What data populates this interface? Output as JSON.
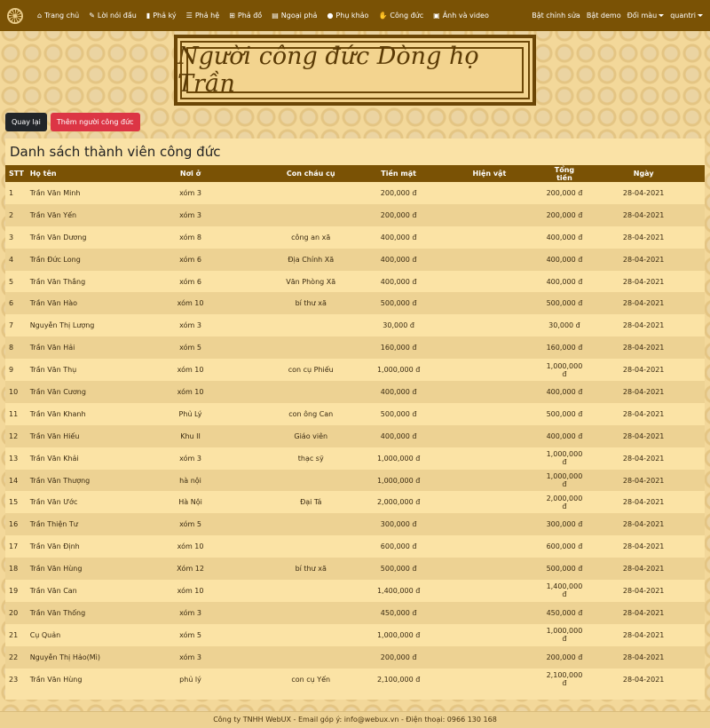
{
  "nav": {
    "items": [
      {
        "icon": "⌂",
        "label": "Trang chủ"
      },
      {
        "icon": "✎",
        "label": "Lời nói đầu"
      },
      {
        "icon": "▮",
        "label": "Phả ký"
      },
      {
        "icon": "☰",
        "label": "Phả hệ"
      },
      {
        "icon": "⊞",
        "label": "Phả đồ"
      },
      {
        "icon": "▤",
        "label": "Ngoại phả"
      },
      {
        "icon": "●",
        "label": "Phụ khảo"
      },
      {
        "icon": "✋",
        "label": "Công đức"
      },
      {
        "icon": "▣",
        "label": "Ảnh và video"
      }
    ],
    "right": {
      "edit": "Bật chỉnh sửa",
      "demo": "Bật demo",
      "color": "Đổi màu",
      "user": "quantri"
    }
  },
  "banner": {
    "title": "Người công đức Dòng họ Trần"
  },
  "actions": {
    "back": "Quay lại",
    "add": "Thêm người công đức"
  },
  "panel": {
    "title": "Danh sách thành viên công đức"
  },
  "table": {
    "headers": [
      "STT",
      "Họ tên",
      "Nơi ở",
      "Con cháu cụ",
      "Tiền mặt",
      "Hiện vật",
      "Tổng tiền",
      "Ngày"
    ],
    "rows": [
      [
        "1",
        "Trần Văn Minh",
        "xóm 3",
        "",
        "200,000 đ",
        "",
        "200,000 đ",
        "28-04-2021"
      ],
      [
        "2",
        "Trần Văn Yến",
        "xóm 3",
        "",
        "200,000 đ",
        "",
        "200,000 đ",
        "28-04-2021"
      ],
      [
        "3",
        "Trần Văn Dương",
        "xóm 8",
        "công an xã",
        "400,000 đ",
        "",
        "400,000 đ",
        "28-04-2021"
      ],
      [
        "4",
        "Trần Đức Long",
        "xóm 6",
        "Địa Chính Xã",
        "400,000 đ",
        "",
        "400,000 đ",
        "28-04-2021"
      ],
      [
        "5",
        "Trần Văn Thắng",
        "xóm 6",
        "Văn Phòng Xã",
        "400,000 đ",
        "",
        "400,000 đ",
        "28-04-2021"
      ],
      [
        "6",
        "Trần Văn Hào",
        "xóm 10",
        "bí thư xã",
        "500,000 đ",
        "",
        "500,000 đ",
        "28-04-2021"
      ],
      [
        "7",
        "Nguyễn Thị Lượng",
        "xóm 3",
        "",
        "30,000 đ",
        "",
        "30,000 đ",
        "28-04-2021"
      ],
      [
        "8",
        "Trần Văn Hải",
        "xóm 5",
        "",
        "160,000 đ",
        "",
        "160,000 đ",
        "28-04-2021"
      ],
      [
        "9",
        "Trần Văn Thụ",
        "xóm 10",
        "con cụ Phiếu",
        "1,000,000 đ",
        "",
        "1,000,000 đ",
        "28-04-2021"
      ],
      [
        "10",
        "Trần Văn Cương",
        "xóm 10",
        "",
        "400,000 đ",
        "",
        "400,000 đ",
        "28-04-2021"
      ],
      [
        "11",
        "Trần Văn Khanh",
        "Phủ Lý",
        "con ông Can",
        "500,000 đ",
        "",
        "500,000 đ",
        "28-04-2021"
      ],
      [
        "12",
        "Trần Văn Hiếu",
        "Khu II",
        "Giáo viên",
        "400,000 đ",
        "",
        "400,000 đ",
        "28-04-2021"
      ],
      [
        "13",
        "Trần Văn Khải",
        "xóm 3",
        "thạc sỹ",
        "1,000,000 đ",
        "",
        "1,000,000 đ",
        "28-04-2021"
      ],
      [
        "14",
        "Trần Văn Thượng",
        "hà nội",
        "",
        "1,000,000 đ",
        "",
        "1,000,000 đ",
        "28-04-2021"
      ],
      [
        "15",
        "Trần Văn Ước",
        "Hà Nội",
        "Đại Tá",
        "2,000,000 đ",
        "",
        "2,000,000 đ",
        "28-04-2021"
      ],
      [
        "16",
        "Trần Thiện Tư",
        "xóm 5",
        "",
        "300,000 đ",
        "",
        "300,000 đ",
        "28-04-2021"
      ],
      [
        "17",
        "Trần Văn Định",
        "xóm 10",
        "",
        "600,000 đ",
        "",
        "600,000 đ",
        "28-04-2021"
      ],
      [
        "18",
        "Trần Văn Hùng",
        "Xóm 12",
        "bí thư xã",
        "500,000 đ",
        "",
        "500,000 đ",
        "28-04-2021"
      ],
      [
        "19",
        "Trần Văn Can",
        "xóm 10",
        "",
        "1,400,000 đ",
        "",
        "1,400,000 đ",
        "28-04-2021"
      ],
      [
        "20",
        "Trần Văn Thống",
        "xóm 3",
        "",
        "450,000 đ",
        "",
        "450,000 đ",
        "28-04-2021"
      ],
      [
        "21",
        "Cụ Quản",
        "xóm 5",
        "",
        "1,000,000 đ",
        "",
        "1,000,000 đ",
        "28-04-2021"
      ],
      [
        "22",
        "Nguyễn Thị Hảo(Mì)",
        "xóm 3",
        "",
        "200,000 đ",
        "",
        "200,000 đ",
        "28-04-2021"
      ],
      [
        "23",
        "Trần Văn Hùng",
        "phủ lý",
        "con cụ Yến",
        "2,100,000 đ",
        "",
        "2,100,000 đ",
        "28-04-2021"
      ]
    ]
  },
  "footer": {
    "text": "Công ty TNHH WebUX - Email góp ý: info@webux.vn - Điện thoại: 0966 130 168"
  }
}
